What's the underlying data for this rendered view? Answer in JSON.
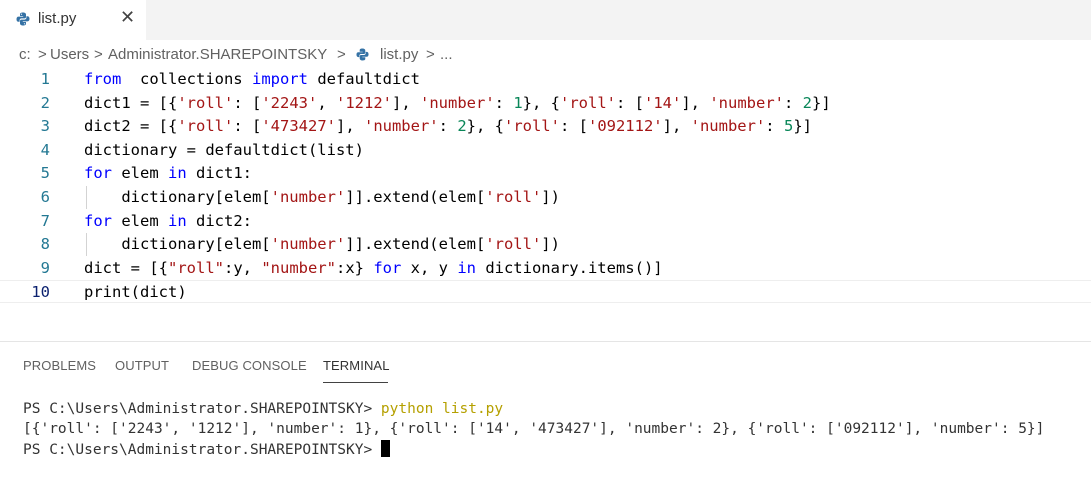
{
  "tab": {
    "filename": "list.py",
    "close_glyph": "✕",
    "icon": "python-file-icon"
  },
  "breadcrumb": {
    "items": [
      "c:",
      "Users",
      "Administrator.SHAREPOINTSKY",
      "list.py",
      "..."
    ],
    "separator": ">"
  },
  "editor": {
    "active_line": 10,
    "lines": [
      {
        "n": "1",
        "tokens": [
          [
            "kw",
            "from"
          ],
          [
            "",
            "  collections "
          ],
          [
            "kw",
            "import"
          ],
          [
            "",
            " defaultdict"
          ]
        ]
      },
      {
        "n": "2",
        "tokens": [
          [
            "",
            "dict1 = [{"
          ],
          [
            "str",
            "'roll'"
          ],
          [
            "",
            ": ["
          ],
          [
            "str",
            "'2243'"
          ],
          [
            "",
            ", "
          ],
          [
            "str",
            "'1212'"
          ],
          [
            "",
            "], "
          ],
          [
            "str",
            "'number'"
          ],
          [
            "",
            ": "
          ],
          [
            "num",
            "1"
          ],
          [
            "",
            "}, {"
          ],
          [
            "str",
            "'roll'"
          ],
          [
            "",
            ": ["
          ],
          [
            "str",
            "'14'"
          ],
          [
            "",
            "], "
          ],
          [
            "str",
            "'number'"
          ],
          [
            "",
            ": "
          ],
          [
            "num",
            "2"
          ],
          [
            "",
            "}]"
          ]
        ]
      },
      {
        "n": "3",
        "tokens": [
          [
            "",
            "dict2 = [{"
          ],
          [
            "str",
            "'roll'"
          ],
          [
            "",
            ": ["
          ],
          [
            "str",
            "'473427'"
          ],
          [
            "",
            "], "
          ],
          [
            "str",
            "'number'"
          ],
          [
            "",
            ": "
          ],
          [
            "num",
            "2"
          ],
          [
            "",
            "}, {"
          ],
          [
            "str",
            "'roll'"
          ],
          [
            "",
            ": ["
          ],
          [
            "str",
            "'092112'"
          ],
          [
            "",
            "], "
          ],
          [
            "str",
            "'number'"
          ],
          [
            "",
            ": "
          ],
          [
            "num",
            "5"
          ],
          [
            "",
            "}]"
          ]
        ]
      },
      {
        "n": "4",
        "tokens": [
          [
            "",
            "dictionary = defaultdict(list)"
          ]
        ]
      },
      {
        "n": "5",
        "tokens": [
          [
            "kw",
            "for"
          ],
          [
            "",
            " elem "
          ],
          [
            "kw",
            "in"
          ],
          [
            "",
            " dict1:"
          ]
        ]
      },
      {
        "n": "6",
        "tokens": [
          [
            "",
            "    dictionary[elem["
          ],
          [
            "str",
            "'number'"
          ],
          [
            "",
            "]].extend(elem["
          ],
          [
            "str",
            "'roll'"
          ],
          [
            "",
            "])"
          ]
        ]
      },
      {
        "n": "7",
        "tokens": [
          [
            "kw",
            "for"
          ],
          [
            "",
            " elem "
          ],
          [
            "kw",
            "in"
          ],
          [
            "",
            " dict2:"
          ]
        ]
      },
      {
        "n": "8",
        "tokens": [
          [
            "",
            "    dictionary[elem["
          ],
          [
            "str",
            "'number'"
          ],
          [
            "",
            "]].extend(elem["
          ],
          [
            "str",
            "'roll'"
          ],
          [
            "",
            "])"
          ]
        ]
      },
      {
        "n": "9",
        "tokens": [
          [
            "",
            "dict = [{"
          ],
          [
            "str",
            "\"roll\""
          ],
          [
            "",
            ":y, "
          ],
          [
            "str",
            "\"number\""
          ],
          [
            "",
            ":x} "
          ],
          [
            "kw",
            "for"
          ],
          [
            "",
            " x, y "
          ],
          [
            "kw",
            "in"
          ],
          [
            "",
            " dictionary.items()]"
          ]
        ]
      },
      {
        "n": "10",
        "tokens": [
          [
            "",
            "print(dict)"
          ]
        ]
      }
    ]
  },
  "panel": {
    "tabs": [
      "PROBLEMS",
      "OUTPUT",
      "DEBUG CONSOLE",
      "TERMINAL"
    ],
    "active_tab": "TERMINAL"
  },
  "terminal": {
    "prompt": "PS C:\\Users\\Administrator.SHAREPOINTSKY> ",
    "command": "python list.py",
    "output": "[{'roll': ['2243', '1212'], 'number': 1}, {'roll': ['14', '473427'], 'number': 2}, {'roll': ['092112'], 'number': 5}]"
  },
  "colors": {
    "keyword": "#0000ff",
    "string": "#a31515",
    "number": "#098658",
    "line_number": "#237893",
    "terminal_command": "#b5a000"
  }
}
